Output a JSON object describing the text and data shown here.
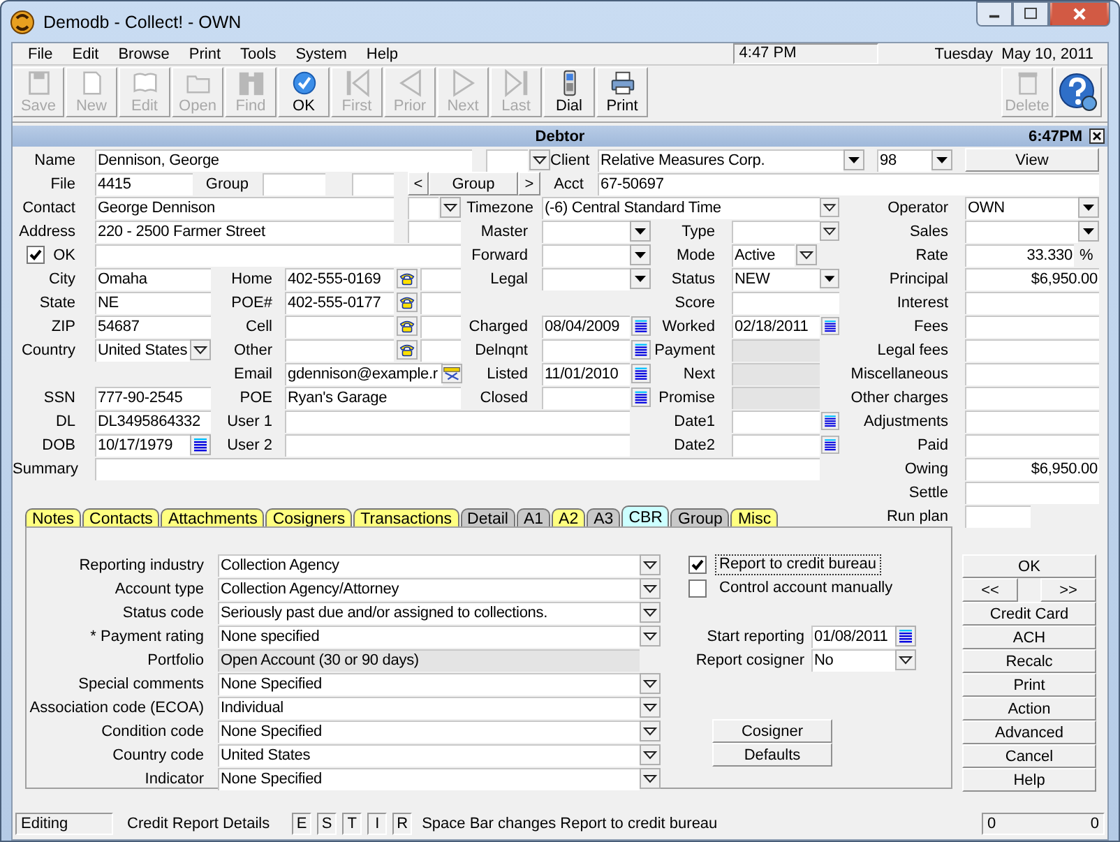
{
  "window": {
    "title": "Demodb - Collect! - OWN"
  },
  "menu": [
    "File",
    "Edit",
    "Browse",
    "Print",
    "Tools",
    "System",
    "Help"
  ],
  "clock": {
    "time": "4:47 PM",
    "date": "Tuesday  May 10, 2011"
  },
  "toolbar": [
    {
      "label": "Save",
      "disabled": true
    },
    {
      "label": "New",
      "disabled": true
    },
    {
      "label": "Edit",
      "disabled": true
    },
    {
      "label": "Open",
      "disabled": true
    },
    {
      "label": "Find",
      "disabled": true
    },
    {
      "label": "OK",
      "disabled": false
    },
    {
      "label": "First",
      "disabled": true
    },
    {
      "label": "Prior",
      "disabled": true
    },
    {
      "label": "Next",
      "disabled": true
    },
    {
      "label": "Last",
      "disabled": true
    },
    {
      "label": "Dial",
      "disabled": false
    },
    {
      "label": "Print",
      "disabled": false
    },
    {
      "label": "Delete",
      "disabled": true
    }
  ],
  "form_header": {
    "title": "Debtor",
    "time": "6:47PM"
  },
  "form": {
    "lines": [
      [
        {
          "kind": "label",
          "text": "Name"
        },
        {
          "kind": "field",
          "value": "Dennison, George"
        },
        {
          "kind": "field"
        },
        {
          "kind": "dropdown"
        },
        {
          "kind": "label",
          "text": "Client"
        },
        {
          "kind": "field",
          "value": "Relative Measures Corp."
        },
        {
          "kind": "dropdown_solid"
        },
        {
          "kind": "field",
          "value": "98"
        },
        {
          "kind": "dropdown_solid"
        },
        {
          "kind": "button",
          "text": "View"
        }
      ],
      [
        {
          "kind": "label",
          "text": "File"
        },
        {
          "kind": "field",
          "value": "4415"
        },
        {
          "kind": "label",
          "text": "Group"
        },
        {
          "kind": "field"
        },
        {
          "kind": "field"
        },
        {
          "kind": "button",
          "text": "<"
        },
        {
          "kind": "button",
          "text": "Group"
        },
        {
          "kind": "button",
          "text": ">"
        },
        {
          "kind": "label",
          "text": "Acct"
        },
        {
          "kind": "field",
          "value": "67-50697"
        }
      ],
      [
        {
          "kind": "label",
          "text": "Contact"
        },
        {
          "kind": "field",
          "value": "George Dennison"
        },
        {
          "kind": "field"
        },
        {
          "kind": "dropdown"
        },
        {
          "kind": "label",
          "text": "Timezone"
        },
        {
          "kind": "field",
          "value": "(-6) Central Standard Time"
        },
        {
          "kind": "dropdown"
        },
        {
          "kind": "label",
          "text": "Operator"
        },
        {
          "kind": "field",
          "value": "OWN"
        },
        {
          "kind": "dropdown_solid"
        }
      ],
      [
        {
          "kind": "label",
          "text": "Address"
        },
        {
          "kind": "field",
          "value": "220 - 2500 Farmer Street"
        },
        {
          "kind": "field"
        },
        {
          "kind": "label",
          "text": "Master"
        },
        {
          "kind": "field"
        },
        {
          "kind": "dropdown_solid"
        },
        {
          "kind": "label",
          "text": "Type"
        },
        {
          "kind": "field"
        },
        {
          "kind": "dropdown"
        },
        {
          "kind": "label",
          "text": "Sales"
        },
        {
          "kind": "field"
        },
        {
          "kind": "dropdown_solid"
        }
      ],
      [
        {
          "kind": "checkbox",
          "checked": true
        },
        {
          "kind": "label",
          "text": "OK"
        },
        {
          "kind": "field"
        },
        {
          "kind": "label",
          "text": "Forward"
        },
        {
          "kind": "field"
        },
        {
          "kind": "dropdown_solid"
        },
        {
          "kind": "label",
          "text": "Mode"
        },
        {
          "kind": "field",
          "value": "Active"
        },
        {
          "kind": "dropdown"
        },
        {
          "kind": "label",
          "text": "Rate"
        },
        {
          "kind": "amount",
          "value": "33.330"
        },
        {
          "kind": "unit",
          "text": "%"
        }
      ],
      [
        {
          "kind": "label",
          "text": "City"
        },
        {
          "kind": "field",
          "value": "Omaha"
        },
        {
          "kind": "label",
          "text": "Home"
        },
        {
          "kind": "field",
          "value": "402-555-0169"
        },
        {
          "kind": "phone"
        },
        {
          "kind": "field"
        },
        {
          "kind": "label",
          "text": "Legal"
        },
        {
          "kind": "field"
        },
        {
          "kind": "dropdown_solid"
        },
        {
          "kind": "label",
          "text": "Status"
        },
        {
          "kind": "field",
          "value": "NEW"
        },
        {
          "kind": "dropdown_solid"
        },
        {
          "kind": "label",
          "text": "Principal"
        },
        {
          "kind": "amount",
          "value": "$6,950.00"
        }
      ],
      [
        {
          "kind": "label",
          "text": "State"
        },
        {
          "kind": "field",
          "value": "NE"
        },
        {
          "kind": "label",
          "text": "POE#"
        },
        {
          "kind": "field",
          "value": "402-555-0177"
        },
        {
          "kind": "phone"
        },
        {
          "kind": "field"
        },
        {
          "kind": "label",
          "text": "Score"
        },
        {
          "kind": "field"
        },
        {
          "kind": "label",
          "text": "Interest"
        },
        {
          "kind": "amount"
        }
      ],
      [
        {
          "kind": "label",
          "text": "ZIP"
        },
        {
          "kind": "field",
          "value": "54687"
        },
        {
          "kind": "label",
          "text": "Cell"
        },
        {
          "kind": "field"
        },
        {
          "kind": "phone"
        },
        {
          "kind": "field"
        },
        {
          "kind": "label",
          "text": "Charged"
        },
        {
          "kind": "field",
          "value": "08/04/2009"
        },
        {
          "kind": "calendar"
        },
        {
          "kind": "label",
          "text": "Worked"
        },
        {
          "kind": "field",
          "value": "02/18/2011"
        },
        {
          "kind": "calendar"
        },
        {
          "kind": "label",
          "text": "Fees"
        },
        {
          "kind": "amount"
        }
      ],
      [
        {
          "kind": "label",
          "text": "Country"
        },
        {
          "kind": "field",
          "value": "United States"
        },
        {
          "kind": "dropdown"
        },
        {
          "kind": "label",
          "text": "Other"
        },
        {
          "kind": "field"
        },
        {
          "kind": "phone"
        },
        {
          "kind": "field"
        },
        {
          "kind": "label",
          "text": "Delnqnt"
        },
        {
          "kind": "field"
        },
        {
          "kind": "calendar"
        },
        {
          "kind": "label",
          "text": "Payment"
        },
        {
          "kind": "readonly"
        },
        {
          "kind": "label",
          "text": "Legal fees"
        },
        {
          "kind": "amount"
        }
      ],
      [
        {
          "kind": "label",
          "text": "Email"
        },
        {
          "kind": "field",
          "value": "gdennison@example.r"
        },
        {
          "kind": "email"
        },
        {
          "kind": "label",
          "text": "Listed"
        },
        {
          "kind": "field",
          "value": "11/01/2010"
        },
        {
          "kind": "calendar"
        },
        {
          "kind": "label",
          "text": "Next"
        },
        {
          "kind": "readonly"
        },
        {
          "kind": "label",
          "text": "Miscellaneous"
        },
        {
          "kind": "amount"
        }
      ],
      [
        {
          "kind": "label",
          "text": "SSN"
        },
        {
          "kind": "field",
          "value": "777-90-2545"
        },
        {
          "kind": "label",
          "text": "POE"
        },
        {
          "kind": "field",
          "value": "Ryan's Garage"
        },
        {
          "kind": "label",
          "text": "Closed"
        },
        {
          "kind": "field"
        },
        {
          "kind": "calendar"
        },
        {
          "kind": "label",
          "text": "Promise"
        },
        {
          "kind": "readonly"
        },
        {
          "kind": "label",
          "text": "Other charges"
        },
        {
          "kind": "amount"
        }
      ],
      [
        {
          "kind": "label",
          "text": "DL"
        },
        {
          "kind": "field",
          "value": "DL3495864332"
        },
        {
          "kind": "label",
          "text": "User 1"
        },
        {
          "kind": "field"
        },
        {
          "kind": "label",
          "text": "Date1"
        },
        {
          "kind": "field"
        },
        {
          "kind": "calendar"
        },
        {
          "kind": "label",
          "text": "Adjustments"
        },
        {
          "kind": "amount"
        }
      ],
      [
        {
          "kind": "label",
          "text": "DOB"
        },
        {
          "kind": "field",
          "value": "10/17/1979"
        },
        {
          "kind": "calendar"
        },
        {
          "kind": "label",
          "text": "User 2"
        },
        {
          "kind": "field"
        },
        {
          "kind": "label",
          "text": "Date2"
        },
        {
          "kind": "field"
        },
        {
          "kind": "calendar"
        },
        {
          "kind": "label",
          "text": "Paid"
        },
        {
          "kind": "amount"
        }
      ],
      [
        {
          "kind": "label",
          "text": "Summary"
        },
        {
          "kind": "field"
        },
        {
          "kind": "label",
          "text": "Owing"
        },
        {
          "kind": "amount",
          "value": "$6,950.00"
        }
      ],
      [
        {
          "kind": "label",
          "text": "Settle"
        },
        {
          "kind": "amount"
        }
      ],
      [
        {
          "kind": "label",
          "text": "Run plan"
        },
        {
          "kind": "field"
        }
      ]
    ]
  },
  "tabs": [
    {
      "label": "Notes",
      "color": "#ffff80",
      "selected": false
    },
    {
      "label": "Contacts",
      "color": "#ffff80",
      "selected": false
    },
    {
      "label": "Attachments",
      "color": "#ffff80",
      "selected": false
    },
    {
      "label": "Cosigners",
      "color": "#ffff80",
      "selected": false
    },
    {
      "label": "Transactions",
      "color": "#ffff80",
      "selected": false
    },
    {
      "label": "Detail",
      "color": "#c8c8c8",
      "selected": false
    },
    {
      "label": "A1",
      "color": "#c8c8c8",
      "selected": false
    },
    {
      "label": "A2",
      "color": "#ffff80",
      "selected": false
    },
    {
      "label": "A3",
      "color": "#c8c8c8",
      "selected": false
    },
    {
      "label": "CBR",
      "color": "#ccffff",
      "selected": true
    },
    {
      "label": "Group",
      "color": "#c8c8c8",
      "selected": false
    },
    {
      "label": "Misc",
      "color": "#ffff80",
      "selected": false
    }
  ],
  "cbr": {
    "fields": [
      {
        "label": "Reporting industry",
        "value": "Collection Agency",
        "kind": "combo"
      },
      {
        "label": "Account type",
        "value": "Collection Agency/Attorney",
        "kind": "combo"
      },
      {
        "label": "Status code",
        "value": "Seriously past due and/or assigned to collections.",
        "kind": "combo"
      },
      {
        "label": "* Payment rating",
        "value": "None specified",
        "kind": "combo"
      },
      {
        "label": "Portfolio",
        "value": "Open Account (30 or 90 days)",
        "kind": "readonly"
      },
      {
        "label": "Special comments",
        "value": "None Specified",
        "kind": "combo"
      },
      {
        "label": "Association code (ECOA)",
        "value": "Individual",
        "kind": "combo"
      },
      {
        "label": "Condition code",
        "value": "None Specified",
        "kind": "combo"
      },
      {
        "label": "Country code",
        "value": "United States",
        "kind": "combo"
      },
      {
        "label": "Indicator",
        "value": "None Specified",
        "kind": "combo"
      }
    ],
    "options": [
      {
        "label": "Report to credit bureau",
        "checked": true,
        "focused": true
      },
      {
        "label": "Control account manually",
        "checked": false,
        "focused": false
      }
    ],
    "start_reporting": {
      "label": "Start reporting",
      "value": "01/08/2011"
    },
    "report_cosigner": {
      "label": "Report cosigner",
      "value": "No"
    },
    "buttons": [
      "Cosigner",
      "Defaults"
    ]
  },
  "side_buttons": [
    "OK",
    "<<",
    ">>",
    "Credit Card",
    "ACH",
    "Recalc",
    "Print",
    "Action",
    "Advanced",
    "Cancel",
    "Help"
  ],
  "status_bar": {
    "mode": "Editing",
    "context": "Credit Report Details",
    "keys": [
      "E",
      "S",
      "T",
      "I",
      "R"
    ],
    "hint": "Space Bar changes Report to credit bureau",
    "counts": [
      "0",
      "0"
    ]
  }
}
